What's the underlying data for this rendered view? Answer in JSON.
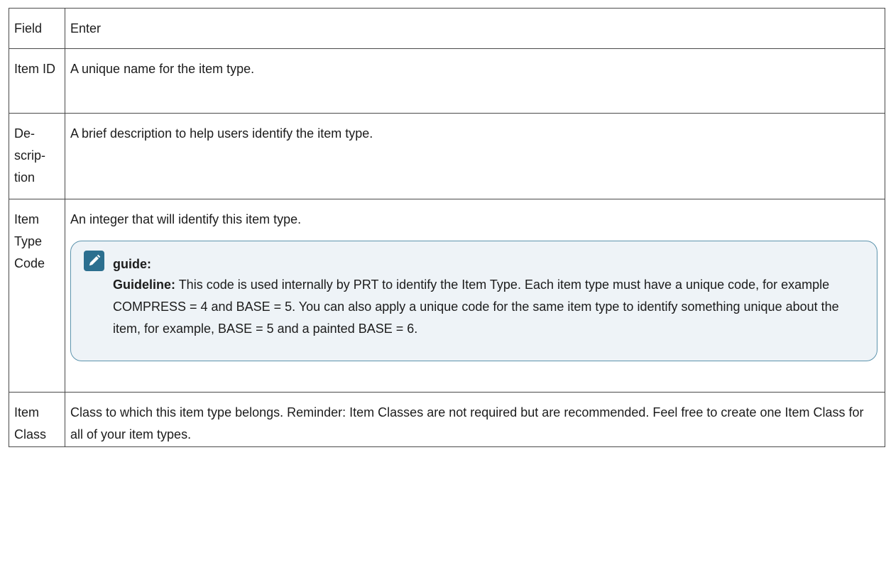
{
  "table": {
    "header": {
      "field": "Field",
      "enter": "Enter"
    },
    "rows": [
      {
        "field": "Item ID",
        "enter": "A unique name for the item type."
      },
      {
        "field": "De­scrip­tion",
        "enter": "A brief description to help users identify the item type."
      },
      {
        "field": "Item Type Code",
        "enter": "An integer that will identify this item type."
      },
      {
        "field": "Item Class",
        "enter": "Class to which this item type belongs. Reminder: Item Classes are not required but are recom­mended. Feel free to create one Item Class for all of your item types."
      }
    ]
  },
  "note": {
    "icon": "pencil-note-icon",
    "title": "guide:",
    "lead": "Guideline:",
    "text": " This code is used internally by PRT to identify the Item Type. Each item type must have a unique code, for example COMPRESS = 4 and BASE = 5. You can also apply a unique code for the same item type to identify something unique about the item, for example, BASE = 5 and a painted BASE = 6.",
    "accent_color": "#2c6f8f",
    "border_color": "#5d94ad",
    "background_color": "#eef3f7"
  }
}
